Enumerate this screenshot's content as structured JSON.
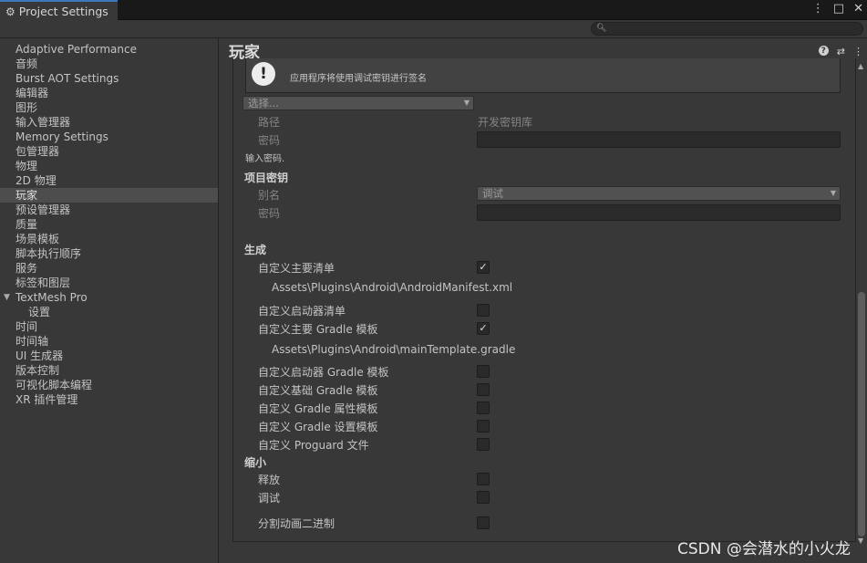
{
  "tab": {
    "title": "Project Settings"
  },
  "search": {
    "placeholder": ""
  },
  "sidebar": {
    "items": [
      "Adaptive Performance",
      "音频",
      "Burst AOT Settings",
      "编辑器",
      "图形",
      "输入管理器",
      "Memory Settings",
      "包管理器",
      "物理",
      "2D 物理",
      "玩家",
      "预设管理器",
      "质量",
      "场景模板",
      "脚本执行顺序",
      "服务",
      "标签和图层",
      "TextMesh Pro",
      "设置",
      "时间",
      "时间轴",
      "UI 生成器",
      "版本控制",
      "可视化脚本编程",
      "XR 插件管理"
    ],
    "active_index": 10
  },
  "main": {
    "title": "玩家",
    "warning": "应用程序将使用调试密钥进行签名",
    "select_placeholder": "选择...",
    "keystore": {
      "path_label": "路径",
      "path_value": "开发密钥库",
      "password_label": "密码",
      "hint": "输入密码."
    },
    "project_key": {
      "header": "项目密钥",
      "alias_label": "别名",
      "alias_value": "调试",
      "password_label": "密码"
    },
    "build": {
      "header": "生成",
      "main_manifest_label": "自定义主要清单",
      "main_manifest_checked": true,
      "main_manifest_path": "Assets\\Plugins\\Android\\AndroidManifest.xml",
      "launcher_manifest_label": "自定义启动器清单",
      "launcher_manifest_checked": false,
      "main_gradle_label": "自定义主要 Gradle 模板",
      "main_gradle_checked": true,
      "main_gradle_path": "Assets\\Plugins\\Android\\mainTemplate.gradle",
      "launcher_gradle_label": "自定义启动器 Gradle 模板",
      "launcher_gradle_checked": false,
      "base_gradle_label": "自定义基础 Gradle 模板",
      "base_gradle_checked": false,
      "gradle_props_label": "自定义 Gradle 属性模板",
      "gradle_props_checked": false,
      "gradle_settings_label": "自定义 Gradle 设置模板",
      "gradle_settings_checked": false,
      "proguard_label": "自定义 Proguard 文件",
      "proguard_checked": false
    },
    "minify": {
      "header": "缩小",
      "release_label": "释放",
      "release_checked": false,
      "debug_label": "调试",
      "debug_checked": false,
      "split_label": "分割动画二进制",
      "split_checked": false
    }
  },
  "watermark": "CSDN @会潜水的小火龙"
}
